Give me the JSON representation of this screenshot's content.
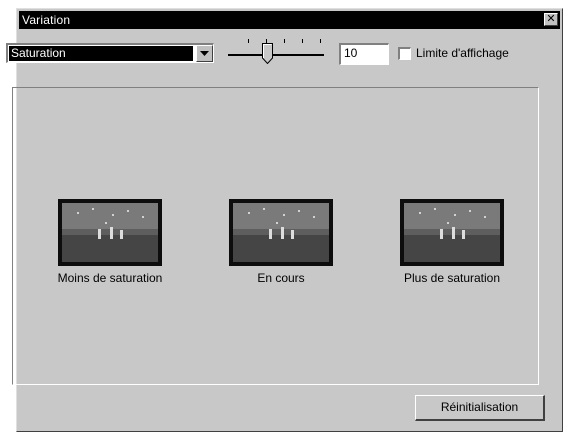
{
  "window": {
    "title": "Variation",
    "close_glyph": "✕"
  },
  "controls": {
    "adjustment_select": {
      "value": "Saturation"
    },
    "step_value": "10",
    "step_slider_fraction": 0.4,
    "limit_checkbox": {
      "label": "Limite d'affichage",
      "checked": false
    }
  },
  "previews": [
    {
      "label": "Moins de saturation"
    },
    {
      "label": "En cours"
    },
    {
      "label": "Plus de saturation"
    }
  ],
  "footer": {
    "reset_label": "Réinitialisation"
  }
}
